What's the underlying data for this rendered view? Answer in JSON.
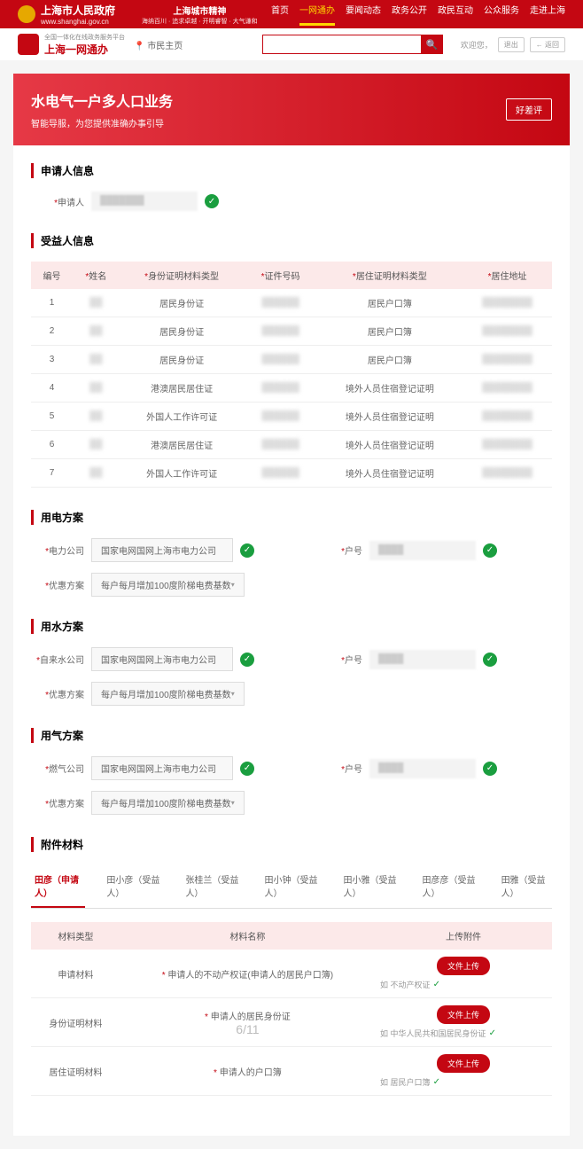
{
  "header": {
    "gov_name": "上海市人民政府",
    "gov_url": "www.shanghai.gov.cn",
    "spirit_title": "上海城市精神",
    "spirit_sub": "海纳百川 · 追求卓越 · 开明睿智 · 大气谦和",
    "nav": [
      "首页",
      "一网通办",
      "要闻动态",
      "政务公开",
      "政民互动",
      "公众服务",
      "走进上海"
    ],
    "nav_active": 1,
    "sub_tag": "全国一体化在线政务服务平台",
    "sub_brand": "上海一网通办",
    "location": "市民主页",
    "welcome": "欢迎您，",
    "logout": "退出",
    "back": "← 返回"
  },
  "title": {
    "main": "水电气一户多人口业务",
    "sub": "智能导服，为您提供准确办事引导",
    "rate": "好差评"
  },
  "sections": {
    "applicant": "申请人信息",
    "beneficiary": "受益人信息",
    "electric": "用电方案",
    "water": "用水方案",
    "gas": "用气方案",
    "attach": "附件材料"
  },
  "labels": {
    "applicant": "申请人",
    "seq": "编号",
    "name": "姓名",
    "id_type": "身份证明材料类型",
    "id_no": "证件号码",
    "res_type": "居住证明材料类型",
    "res_addr": "居住地址",
    "elec_co": "电力公司",
    "water_co": "自来水公司",
    "gas_co": "燃气公司",
    "account": "户号",
    "plan": "优惠方案",
    "mat_type": "材料类型",
    "mat_name": "材料名称",
    "upload": "上传附件"
  },
  "beneficiaries": [
    {
      "seq": "1",
      "id_type": "居民身份证",
      "res_type": "居民户口簿"
    },
    {
      "seq": "2",
      "id_type": "居民身份证",
      "res_type": "居民户口簿"
    },
    {
      "seq": "3",
      "id_type": "居民身份证",
      "res_type": "居民户口簿"
    },
    {
      "seq": "4",
      "id_type": "港澳居民居住证",
      "res_type": "境外人员住宿登记证明"
    },
    {
      "seq": "5",
      "id_type": "外国人工作许可证",
      "res_type": "境外人员住宿登记证明"
    },
    {
      "seq": "6",
      "id_type": "港澳居民居住证",
      "res_type": "境外人员住宿登记证明"
    },
    {
      "seq": "7",
      "id_type": "外国人工作许可证",
      "res_type": "境外人员住宿登记证明"
    }
  ],
  "company_value": "国家电网国网上海市电力公司",
  "plan_value": "每户每月增加100度阶梯电费基数",
  "attach_tabs": [
    "田彦（申请人）",
    "田小彦（受益人）",
    "张桂兰（受益人）",
    "田小钟（受益人）",
    "田小雅（受益人）",
    "田彦彦（受益人）",
    "田雅（受益人）"
  ],
  "attachments": [
    {
      "type": "申请材料",
      "name": "申请人的不动产权证(申请人的居民户口簿)",
      "hint": "不动产权证"
    },
    {
      "type": "身份证明材料",
      "name": "申请人的居民身份证",
      "page": "6/11",
      "hint": "中华人民共和国居民身份证"
    },
    {
      "type": "居住证明材料",
      "name": "申请人的户口簿",
      "hint": "居民户口簿"
    }
  ],
  "upload_btn": "文件上传",
  "hint_prefix": "如"
}
